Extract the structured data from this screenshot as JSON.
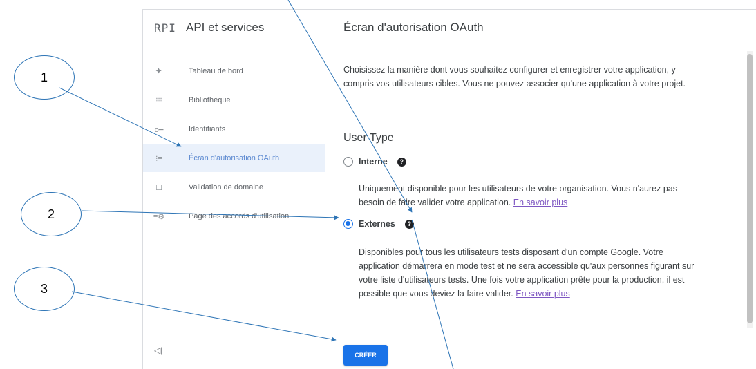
{
  "header": {
    "api_logo": "RPI",
    "app_title": "API et services",
    "page_title": "Écran d'autorisation OAuth"
  },
  "sidebar": {
    "items": [
      {
        "icon": "dashboard-icon",
        "glyph": "⯌",
        "label": "Tableau de bord",
        "active": false
      },
      {
        "icon": "library-icon",
        "glyph": "⁞⁞⁞",
        "label": "Bibliothèque",
        "active": false
      },
      {
        "icon": "key-icon",
        "glyph": "o━",
        "label": "Identifiants",
        "active": false
      },
      {
        "icon": "consent-screen-icon",
        "glyph": "⁝≡",
        "label": "Écran d'autorisation OAuth",
        "active": true
      },
      {
        "icon": "domain-verification-icon",
        "glyph": "☐",
        "label": "Validation de domaine",
        "active": false
      },
      {
        "icon": "usage-agreements-icon",
        "glyph": "≡⚙",
        "label": "Page des accords d'utilisation",
        "active": false
      }
    ],
    "collapse_glyph": "◁|"
  },
  "main": {
    "intro": "Choisissez la manière dont vous souhaitez configurer et enregistrer votre application, y compris vos utilisateurs cibles. Vous ne pouvez associer qu'une application à votre projet.",
    "user_type_heading": "User Type",
    "internal": {
      "label": "Interne",
      "selected": false,
      "description": "Uniquement disponible pour les utilisateurs de votre organisation. Vous n'aurez pas besoin de faire valider votre application.",
      "link": "En savoir plus"
    },
    "external": {
      "label": "Externes",
      "selected": true,
      "description": "Disponibles pour tous les utilisateurs tests disposant d'un compte Google. Votre application démarrera en mode test et ne sera accessible qu'aux personnes figurant sur votre liste d'utilisateurs tests. Une fois votre application prête pour la production, il est possible que vous deviez la faire valider.",
      "link": "En savoir plus"
    },
    "help_glyph": "?",
    "create_button": "CRÉER"
  },
  "annotations": [
    "1",
    "2",
    "3"
  ],
  "colors": {
    "accent": "#1a73e8",
    "active_bg": "#eaf1fb",
    "link": "#7e57c2",
    "annotation_stroke": "#2e75b6"
  }
}
